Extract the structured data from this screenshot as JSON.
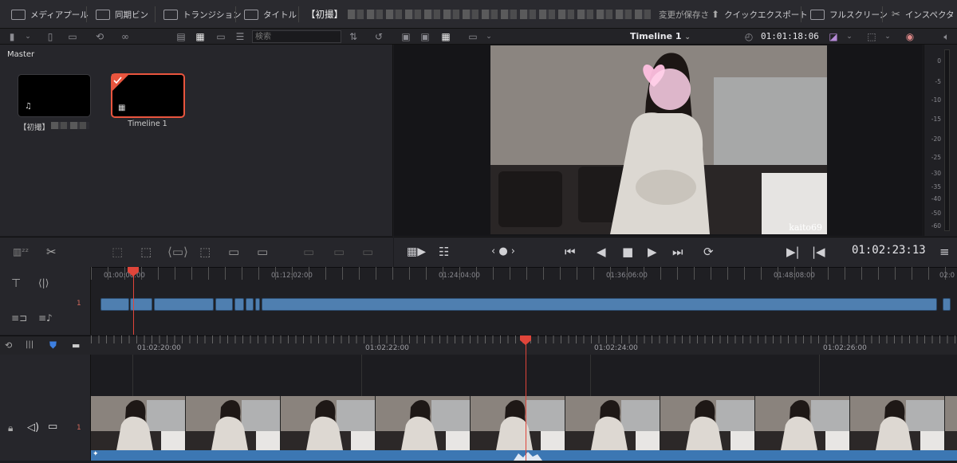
{
  "toolbar": {
    "media_pool": "メディアプール",
    "sync_bin": "同期ビン",
    "transitions": "トランジション",
    "titles": "タイトル",
    "project_title": "【初撮】",
    "save_status": "変更が保存さ",
    "quick_export": "クイックエクスポート",
    "fullscreen": "フルスクリーン",
    "inspector": "インスペクタ"
  },
  "mediapool": {
    "search_placeholder": "検索",
    "bin_name": "Master",
    "clips": [
      {
        "label": "【初撮】",
        "icon": "music-note-icon",
        "selected": false
      },
      {
        "label": "Timeline 1",
        "icon": "timeline-icon",
        "selected": true
      }
    ]
  },
  "viewer": {
    "timeline_name": "Timeline 1",
    "source_timecode": "01:01:18:06",
    "watermark": "kaito69",
    "timecode": "01:02:23:13"
  },
  "meters": {
    "labels": [
      "0",
      "-5",
      "-10",
      "-15",
      "-20",
      "-25",
      "-30",
      "-35",
      "-40",
      "-50",
      "-60"
    ]
  },
  "upper_timeline": {
    "track_number": "1",
    "ruler": [
      "01:00:00:00",
      "01:12:02:00",
      "01:24:04:00",
      "01:36:06:00",
      "01:48:08:00",
      "02:0"
    ]
  },
  "lower_timeline": {
    "track_number": "1",
    "ruler": [
      "01:02:20:00",
      "01:02:22:00",
      "01:02:24:00",
      "01:02:26:00"
    ]
  },
  "colors": {
    "accent_red": "#e0453a",
    "clip_blue": "#4f7fb0",
    "audio_blue": "#3c77b3",
    "panel": "#26262b"
  }
}
